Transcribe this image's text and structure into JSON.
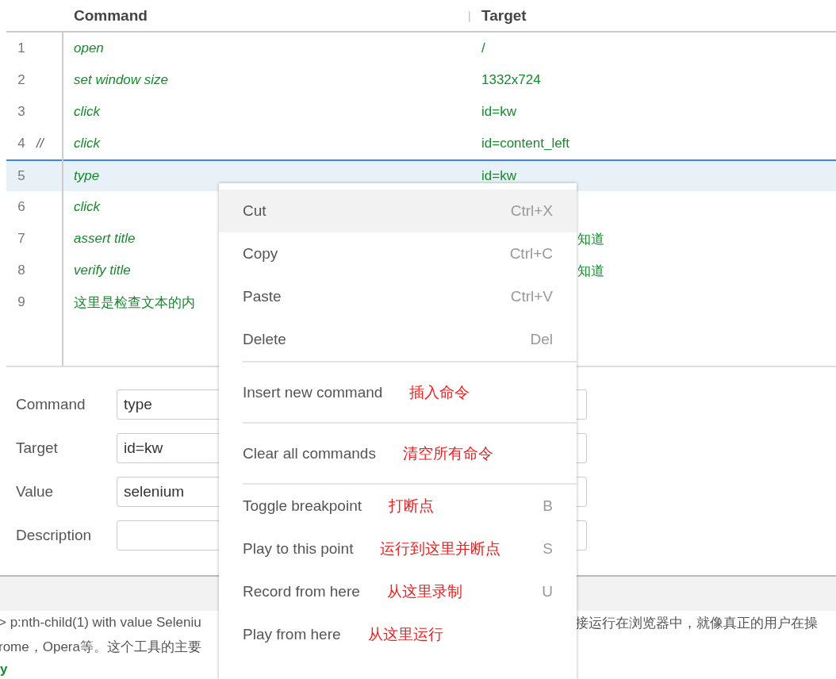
{
  "table": {
    "columns": [
      "Command",
      "Target"
    ],
    "column_separator": "|",
    "rows": [
      {
        "number": "1",
        "kind": "command",
        "selected": false,
        "command": "open",
        "target": "/"
      },
      {
        "number": "2",
        "kind": "command",
        "selected": false,
        "command": "set window size",
        "target": "1332x724"
      },
      {
        "number": "3",
        "kind": "command",
        "selected": false,
        "command": "click",
        "target": "id=kw"
      },
      {
        "number": "4",
        "kind": "command",
        "comment_mark": "//",
        "selected": false,
        "command": "click",
        "target": "id=content_left"
      },
      {
        "number": "5",
        "kind": "command",
        "selected": true,
        "command": "type",
        "target": "id=kw"
      },
      {
        "number": "6",
        "kind": "command",
        "selected": false,
        "command": "click"
      },
      {
        "number": "7",
        "kind": "command",
        "selected": false,
        "command": "assert title",
        "target": "知道",
        "target_cut": true
      },
      {
        "number": "8",
        "kind": "command",
        "selected": false,
        "command": "verify title",
        "target": "知道",
        "target_cut": true
      },
      {
        "number": "9",
        "kind": "comment",
        "selected": false,
        "command": "这里是检查文本的内"
      }
    ]
  },
  "editor": {
    "fields": [
      {
        "label": "Command",
        "value": "type"
      },
      {
        "label": "Target",
        "value": "id=kw"
      },
      {
        "label": "Value",
        "value": "selenium"
      },
      {
        "label": "Description"
      }
    ]
  },
  "log": {
    "lines": [
      {
        "left": "> p:nth-child(1) with value Seleniu",
        "right": "接运行在浏览器中，就像真正的用户在操"
      },
      {
        "left": "rome，Opera等。这个工具的主要"
      }
    ],
    "status": "y"
  },
  "context_menu": {
    "groups": [
      [
        {
          "label": "Cut",
          "shortcut": "Ctrl+X",
          "selected": true
        },
        {
          "label": "Copy",
          "shortcut": "Ctrl+C",
          "selected": false
        },
        {
          "label": "Paste",
          "shortcut": "Ctrl+V",
          "selected": false
        },
        {
          "label": "Delete",
          "shortcut": "Del",
          "selected": false
        }
      ],
      [
        {
          "label": "Insert new command",
          "annotation": "插入命令",
          "selected": false
        }
      ],
      [
        {
          "label": "Clear all commands",
          "annotation": "清空所有命令",
          "selected": false
        }
      ],
      [
        {
          "label": "Toggle breakpoint",
          "annotation": "打断点",
          "shortcut": "B",
          "selected": false
        },
        {
          "label": "Play to this point",
          "annotation": "运行到这里并断点",
          "shortcut": "S",
          "selected": false
        },
        {
          "label": "Record from here",
          "annotation": "从这里录制",
          "shortcut": "U",
          "selected": false
        },
        {
          "label": "Play from here",
          "annotation": "从这里运行",
          "selected": false
        }
      ]
    ]
  }
}
